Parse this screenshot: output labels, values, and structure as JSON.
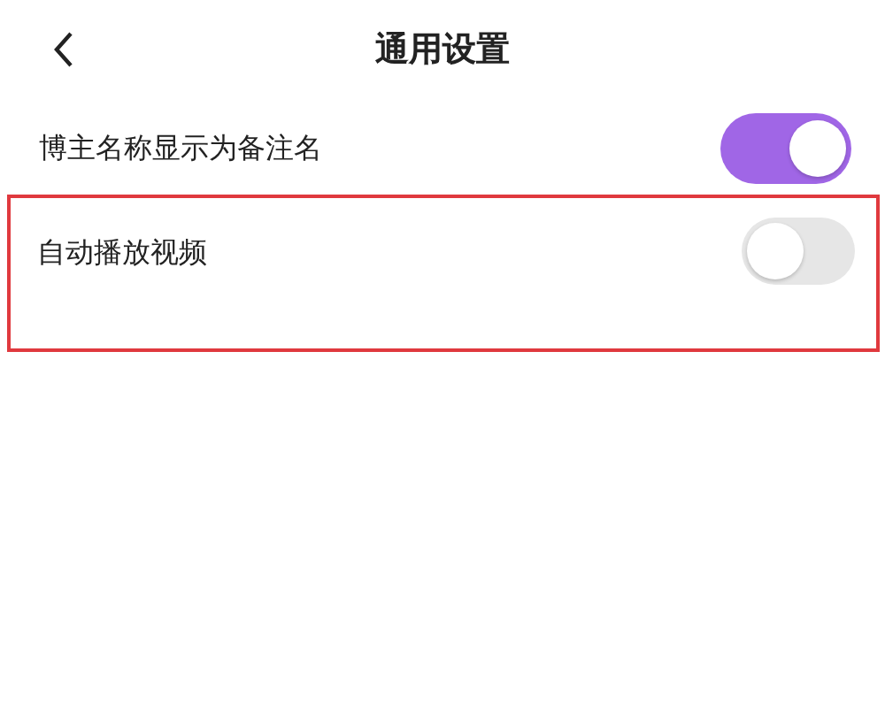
{
  "header": {
    "title": "通用设置"
  },
  "settings": [
    {
      "label": "博主名称显示为备注名",
      "on": true,
      "highlighted": false
    },
    {
      "label": "自动播放视频",
      "on": false,
      "highlighted": true
    }
  ]
}
